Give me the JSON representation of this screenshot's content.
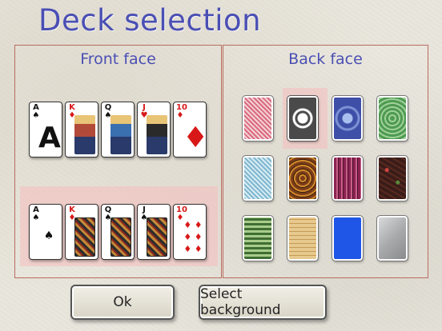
{
  "window": {
    "title": "Deck selection"
  },
  "front_panel": {
    "label": "Front face",
    "deck1": [
      {
        "rank": "A",
        "suit": "♠",
        "color": "black"
      },
      {
        "rank": "K",
        "suit": "♦",
        "color": "red"
      },
      {
        "rank": "Q",
        "suit": "♠",
        "color": "black"
      },
      {
        "rank": "J",
        "suit": "♥",
        "color": "red"
      },
      {
        "rank": "10",
        "suit": "♦",
        "color": "red"
      }
    ],
    "deck2": [
      {
        "rank": "A",
        "suit": "♠",
        "color": "black"
      },
      {
        "rank": "K",
        "suit": "♦",
        "color": "red"
      },
      {
        "rank": "Q",
        "suit": "♠",
        "color": "black"
      },
      {
        "rank": "J",
        "suit": "♠",
        "color": "black"
      },
      {
        "rank": "10",
        "suit": "♦",
        "color": "red"
      }
    ],
    "selected_deck": 2
  },
  "back_panel": {
    "label": "Back face",
    "selected_index": 1,
    "backs": [
      {
        "name": "red-diamond-pattern",
        "color": "#d96a7e"
      },
      {
        "name": "black-white-ornate",
        "color": "#4a4a4a"
      },
      {
        "name": "blue-ornate",
        "color": "#3e4fa8"
      },
      {
        "name": "green-ornate",
        "color": "#4f9a52"
      },
      {
        "name": "light-blue-diamond",
        "color": "#7fb6cf"
      },
      {
        "name": "brown-pattern",
        "color": "#7b3d1a"
      },
      {
        "name": "purple-stripes",
        "color": "#8b2351"
      },
      {
        "name": "dark-floral",
        "color": "#3a1c18"
      },
      {
        "name": "green-tile",
        "color": "#3f6e34"
      },
      {
        "name": "tan-plaid",
        "color": "#e6c98e"
      },
      {
        "name": "solid-blue",
        "color": "#1f56e8"
      },
      {
        "name": "silver-gray",
        "color": "#a9aaac"
      }
    ]
  },
  "buttons": {
    "ok": "Ok",
    "select_background": "Select background"
  }
}
